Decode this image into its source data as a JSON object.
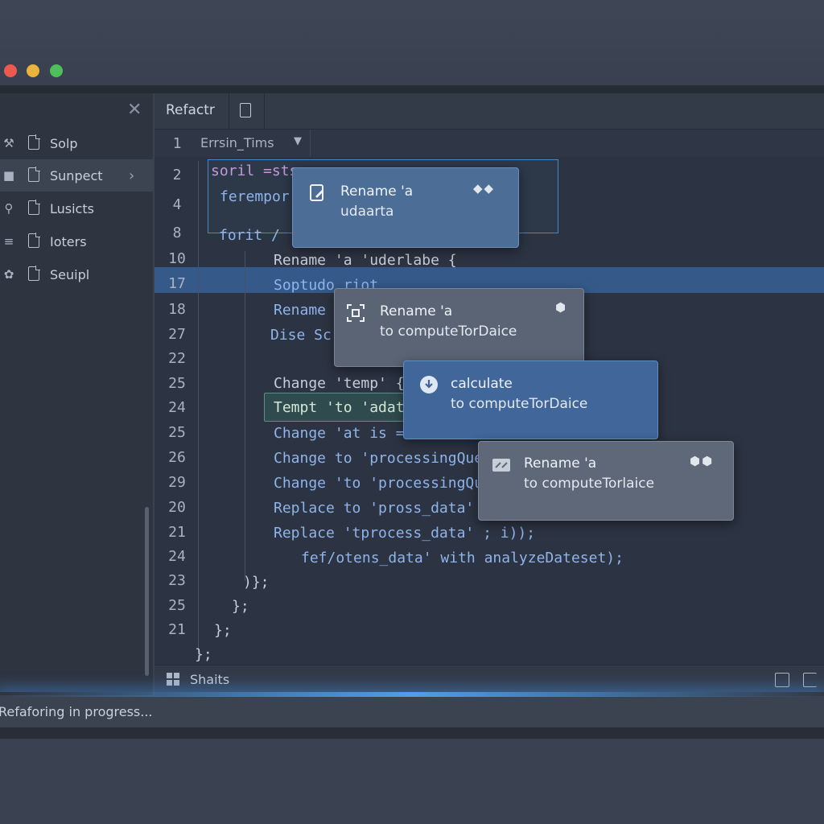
{
  "window": {
    "controls": [
      "close",
      "minimize",
      "maximize"
    ]
  },
  "sidebar": {
    "items": [
      {
        "label": "Solp",
        "icon": "wrench-icon"
      },
      {
        "label": "Sunpect",
        "icon": "folder-icon",
        "active": true
      },
      {
        "label": "Lusicts",
        "icon": "search-icon"
      },
      {
        "label": "Ioters",
        "icon": "menu-icon"
      },
      {
        "label": "Seuipl",
        "icon": "gear-icon"
      }
    ]
  },
  "tabs": {
    "active_label": "Refactr"
  },
  "breadcrumb": {
    "label": "Errsin_Tims"
  },
  "line_numbers": [
    "1",
    "2",
    "4",
    "8",
    "10",
    "17",
    "18",
    "27",
    "22",
    "25",
    "24",
    "25",
    "26",
    "29",
    "20",
    "21",
    "24",
    "23",
    "25",
    "21"
  ],
  "code": {
    "l2": "soril =sts",
    "l4": "ferempor",
    "l8": "forit /",
    "l10": "Rename 'a 'uderlabe {",
    "l17": "Soptudo riot",
    "l18": "Rename",
    "l27": "Dise Sc",
    "l25a": "Change 'temp' {",
    "l24a": "Tempt 'to 'adati",
    "l25b": "Change 'at is =",
    "l26": "Change to 'processingQue",
    "l29": "Change 'to 'processingQu",
    "l20": "Replace to 'pross_data'",
    "l21a": "Replace 'tprocess_data' ; i));",
    "l24b": "fef/otens_data' with analyzeDateset);",
    "l23": ")};",
    "l25c": "};",
    "l21b": "};",
    "l_end": "};"
  },
  "popups": [
    {
      "title": "Rename 'a",
      "subtitle": "udaarta",
      "icon": "file-edit-icon"
    },
    {
      "title": "Rename 'a",
      "subtitle": "to computeTorDaice",
      "icon": "focus-icon"
    },
    {
      "title": "calculate",
      "subtitle": "to computeTorDaice",
      "icon": "download-icon"
    },
    {
      "title": "Rename 'a",
      "subtitle": "to computeTorlaice",
      "icon": "refactor-icon"
    }
  ],
  "statusbar": {
    "label": "Shaits"
  },
  "bottom_status": "Refaforing in progress...",
  "colors": {
    "accent": "#355a8a",
    "glow": "#4fa0ff",
    "close": "#ec5a4f",
    "minimize": "#e9b43b",
    "maximize": "#4fbd5a"
  }
}
